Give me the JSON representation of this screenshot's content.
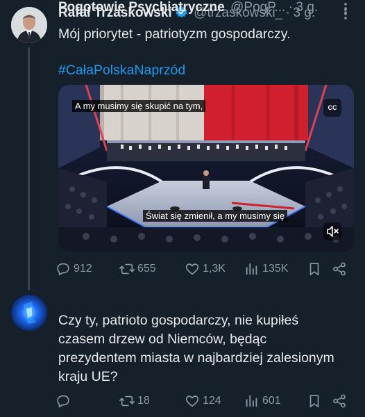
{
  "tweet1": {
    "author_name": "Rafał Trzaskowski",
    "handle": "@trzaskowski_",
    "separator": "·",
    "time": "3 g.",
    "text": "Mój priorytet - patriotyzm gospodarczy.",
    "hashtag": "#CałaPolskaNaprzód",
    "video": {
      "subtitle_top": "A my musimy się skupić na tym,",
      "subtitle_bottom": "Świat się zmienił, a my musimy się",
      "cc_label": "CC"
    },
    "stats": {
      "replies": "912",
      "reposts": "655",
      "likes": "1,3K",
      "views": "135K"
    }
  },
  "tweet2": {
    "author_name": "Pogotowie Psychiatryczne",
    "handle": "@PogP...",
    "separator": "·",
    "time": "3 g.",
    "text": "Czy ty, patrioto gospodarczy, nie kupiłeś czasem drzew od Niemców, będąc prezydentem miasta w najbardziej zalesionym kraju UE?",
    "stats": {
      "replies": "",
      "reposts": "18",
      "likes": "124",
      "views": "601"
    }
  },
  "icons": {
    "verified": "verified-badge-icon",
    "more": "more-dots-icon",
    "reply": "reply-bubble-icon",
    "repost": "repost-arrows-icon",
    "like": "heart-icon",
    "views": "bar-chart-icon",
    "bookmark": "bookmark-icon",
    "share": "share-icon",
    "mute": "speaker-muted-icon"
  },
  "colors": {
    "background": "#15202b",
    "text_primary": "#e7e9ea",
    "text_secondary": "#8b98a5",
    "accent": "#1d9bf0",
    "thread_line": "#38444d"
  }
}
